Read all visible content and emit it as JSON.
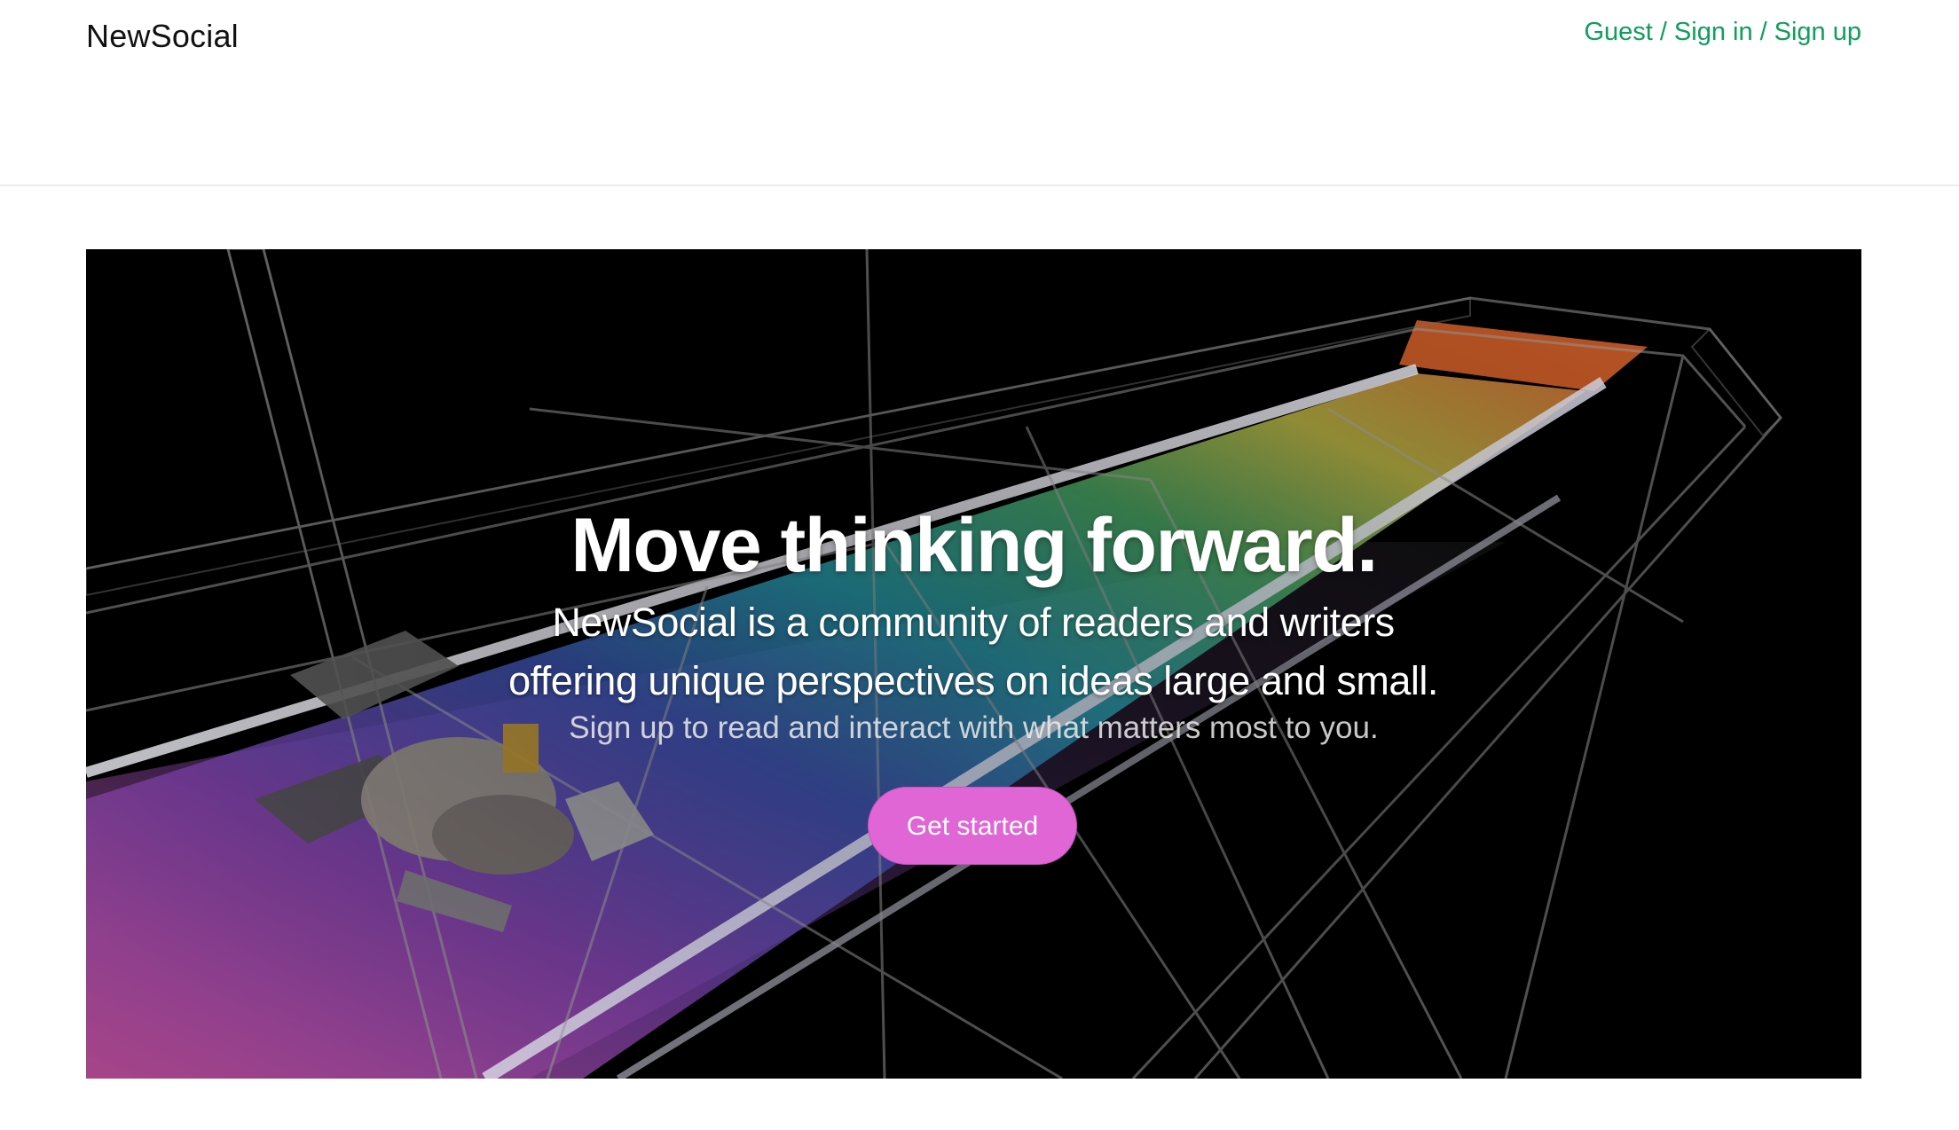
{
  "header": {
    "brand": "NewSocial",
    "auth": {
      "guest": "Guest",
      "sign_in": "Sign in",
      "sign_up": "Sign up",
      "separator": "/"
    }
  },
  "hero": {
    "title": "Move thinking forward.",
    "subtitle": "NewSocial is a community of readers and writers offering unique perspectives on ideas large and small.",
    "tagline": "Sign up to read and interact with what matters most to you.",
    "cta_label": "Get started"
  },
  "colors": {
    "link_green": "#0e9f5b",
    "cta_pink": "#e066d6",
    "hero_background": "#000000"
  }
}
